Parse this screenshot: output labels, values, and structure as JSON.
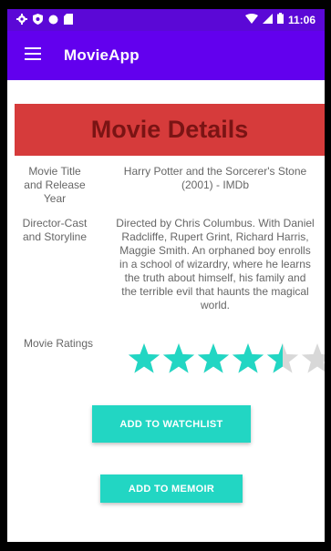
{
  "status_bar": {
    "time": "11:06",
    "icons": [
      "gear-icon",
      "shield-icon",
      "circle-icon",
      "sd-card-icon",
      "wifi-icon",
      "signal-icon",
      "battery-icon"
    ]
  },
  "app_bar": {
    "title": "MovieApp",
    "menu_icon": "hamburger-menu-icon"
  },
  "banner": {
    "title": "Movie Details"
  },
  "details": {
    "title_label_line1": "Movie Title",
    "title_label_line2": "and Release",
    "title_label_line3": "Year",
    "title_value_line1": "Harry Potter and the Sorcerer's Stone",
    "title_value_line2": "(2001) - IMDb",
    "director_label_line1": "Director-Cast",
    "director_label_line2": "and Storyline",
    "director_value_lines": [
      "Directed by Chris Columbus.  With Daniel",
      "Radcliffe, Rupert Grint, Richard Harris,",
      "Maggie Smith. An orphaned boy enrolls",
      "in a school of wizardry, where he learns",
      "the truth about himself, his family and",
      "the terrible evil that haunts the magical",
      "world."
    ],
    "ratings_label": "Movie Ratings",
    "rating_value": 4.5,
    "rating_max": 6
  },
  "buttons": {
    "watchlist": "ADD TO WATCHLIST",
    "memoir": "ADD TO MEMOIR"
  },
  "colors": {
    "status_bar": "#5b08d6",
    "app_bar": "#6200ee",
    "banner_bg": "#d63b3b",
    "banner_text": "#7a1414",
    "accent": "#22d6c3",
    "star_empty": "#d8d8d8"
  }
}
